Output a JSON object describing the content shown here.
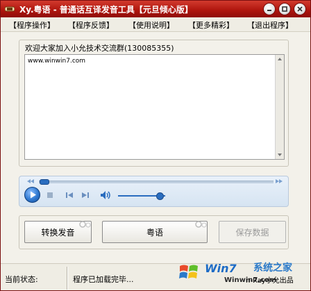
{
  "window": {
    "title": "Xy.粤语 - 普通话互译发音工具【元旦倾心版】"
  },
  "menu": {
    "items": [
      "【程序操作】",
      "【程序反馈】",
      "【使用说明】",
      "【更多精彩】",
      "【退出程序】"
    ]
  },
  "group": {
    "label": "欢迎大家加入小允技术交流群(130085355)",
    "text": "www.winwin7.com"
  },
  "buttons": {
    "convert": "转换发音",
    "language": "粤语",
    "save": "保存数据"
  },
  "status": {
    "label": "当前状态:",
    "text": "程序已加载完毕...",
    "sub": "n-Ray小允出品"
  },
  "watermark": {
    "brand": "Win7",
    "cn": "系统之家",
    "url": "Winwin7.com"
  },
  "colors": {
    "titlebar": "#b1170f",
    "accent": "#2a6dbf"
  },
  "icons": [
    "app-icon",
    "minimize-icon",
    "maximize-icon",
    "close-icon",
    "play-icon",
    "stop-icon",
    "previous-icon",
    "next-icon",
    "volume-icon",
    "windows-logo-icon"
  ]
}
